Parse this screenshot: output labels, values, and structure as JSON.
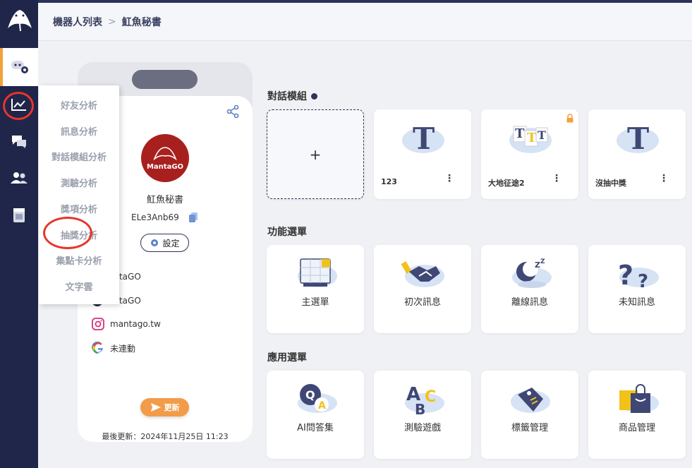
{
  "breadcrumb": {
    "parent": "機器人列表",
    "separator": ">",
    "current": "魟魚秘書"
  },
  "sidebar": {
    "icons": [
      "robot-settings-icon",
      "analytics-chart-icon",
      "chat-bubbles-icon",
      "users-icon",
      "ai-document-icon"
    ]
  },
  "analytics_menu": {
    "items": [
      "好友分析",
      "訊息分析",
      "對話模組分析",
      "測驗分析",
      "獎項分析",
      "抽獎分析",
      "集點卡分析",
      "文字雲"
    ],
    "highlighted": "抽獎分析"
  },
  "bot_profile": {
    "avatar_text": "MantaGO",
    "name": "魟魚秘書",
    "id": "ELe3Anb69",
    "settings_label": "設定",
    "social": [
      {
        "icon": "line-icon",
        "text": "antaGO"
      },
      {
        "icon": "facebook-icon",
        "text": "antaGO"
      },
      {
        "icon": "instagram-icon",
        "text": "mantago.tw"
      },
      {
        "icon": "google-icon",
        "text": "未連動"
      }
    ],
    "update_label": "更新",
    "last_update": "最後更新：2024年11月25日 11:23"
  },
  "sections": {
    "dialog_modules": {
      "title": "對話模組",
      "add_label": "+",
      "cards": [
        {
          "label": "123",
          "locked": false
        },
        {
          "label": "大地征途2",
          "locked": true
        },
        {
          "label": "沒抽中獎",
          "locked": false
        }
      ],
      "menu_glyph": "⋮"
    },
    "function_menu": {
      "title": "功能選單",
      "cards": [
        "主選單",
        "初次訊息",
        "離線訊息",
        "未知訊息"
      ]
    },
    "app_menu": {
      "title": "應用選單",
      "cards": [
        "AI問答集",
        "測驗遊戲",
        "標籤管理",
        "商品管理"
      ]
    }
  },
  "colors": {
    "sidebar": "#1f2649",
    "accent": "#f2a23a",
    "highlight_ring": "#e8352b",
    "update_button": "#f29c4a"
  }
}
